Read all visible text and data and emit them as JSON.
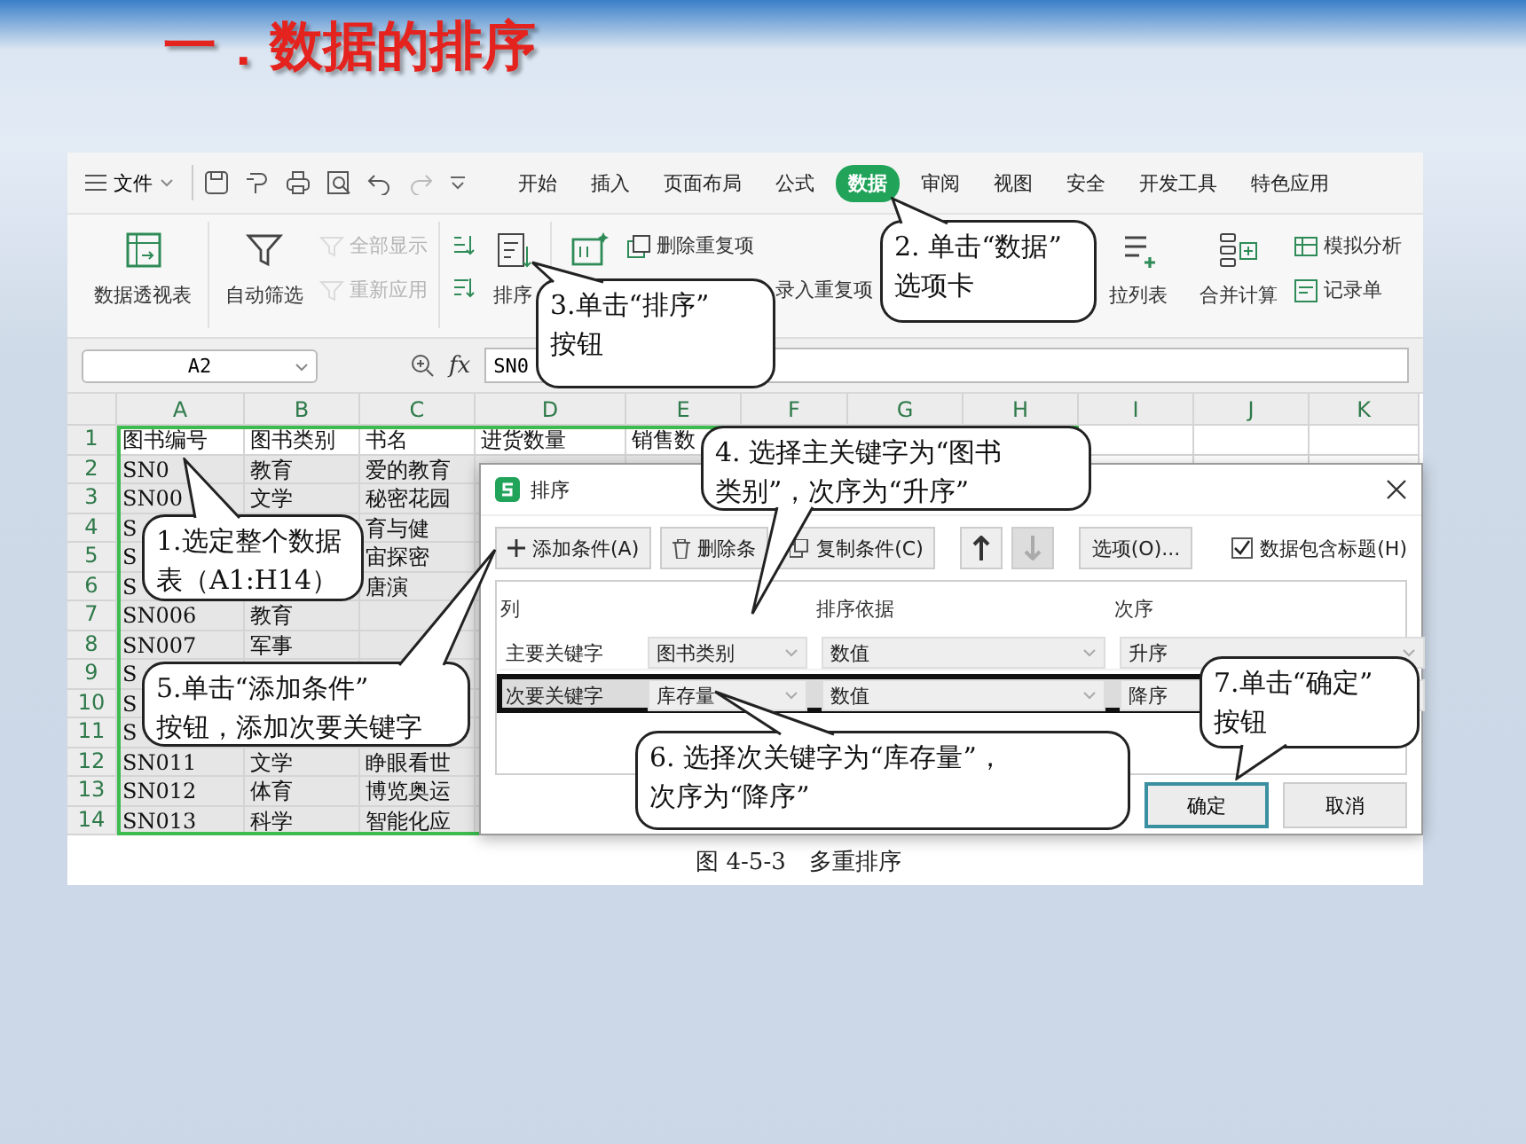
{
  "slide_title": "一．数据的排序",
  "menu": {
    "file": "文件",
    "tabs": [
      {
        "label": "开始",
        "selected": false
      },
      {
        "label": "插入",
        "selected": false
      },
      {
        "label": "页面布局",
        "selected": false
      },
      {
        "label": "公式",
        "selected": false
      },
      {
        "label": "数据",
        "selected": true
      },
      {
        "label": "审阅",
        "selected": false
      },
      {
        "label": "视图",
        "selected": false
      },
      {
        "label": "安全",
        "selected": false
      },
      {
        "label": "开发工具",
        "selected": false
      },
      {
        "label": "特色应用",
        "selected": false
      }
    ]
  },
  "ribbon": {
    "groups": [
      {
        "items": [
          {
            "kind": "large",
            "label": "数据透视表",
            "disabled": false
          }
        ]
      },
      {
        "items": [
          {
            "kind": "large",
            "label": "自动筛选",
            "disabled": false
          },
          {
            "kind": "small",
            "label": "全部显示",
            "disabled": true
          },
          {
            "kind": "small",
            "label": "重新应用",
            "disabled": true
          }
        ]
      },
      {
        "items": [
          {
            "kind": "icon",
            "disabled": false
          },
          {
            "kind": "icon",
            "disabled": false
          },
          {
            "kind": "large",
            "label": "排序",
            "disabled": false
          }
        ]
      },
      {
        "items": [
          {
            "kind": "large",
            "disabled": false
          },
          {
            "kind": "small",
            "label": "删除重复项",
            "disabled": false
          },
          {
            "kind": "small",
            "label": "录入重复项",
            "disabled": false
          }
        ]
      },
      {
        "items": [
          {
            "kind": "large",
            "label": "拉列表",
            "disabled": false
          }
        ]
      },
      {
        "items": [
          {
            "kind": "large",
            "label": "合并计算",
            "disabled": false
          },
          {
            "kind": "small",
            "label": "模拟分析",
            "disabled": false
          },
          {
            "kind": "small",
            "label": "记录单",
            "disabled": false
          }
        ]
      }
    ]
  },
  "formula_bar": {
    "name_box": "A2",
    "fx": "fx",
    "value": "SN0"
  },
  "sheet": {
    "columns": [
      "A",
      "B",
      "C",
      "D",
      "E",
      "F",
      "G",
      "H",
      "I",
      "J",
      "K"
    ],
    "rows": [
      {
        "number": "1",
        "cells": [
          "图书编号",
          "图书类别",
          "书名",
          "进货数量",
          "销售数"
        ]
      },
      {
        "number": "2",
        "cells": [
          "SN0",
          "教育",
          "爱的教育"
        ]
      },
      {
        "number": "3",
        "cells": [
          "SN00",
          "文学",
          "秘密花园"
        ]
      },
      {
        "number": "4",
        "cells": [
          "S",
          "",
          "育与健"
        ]
      },
      {
        "number": "5",
        "cells": [
          "S",
          "",
          "宙探密"
        ]
      },
      {
        "number": "6",
        "cells": [
          "S",
          "",
          "唐演"
        ]
      },
      {
        "number": "7",
        "cells": [
          "SN006",
          "教育",
          ""
        ]
      },
      {
        "number": "8",
        "cells": [
          "SN007",
          "军事",
          ""
        ]
      },
      {
        "number": "9",
        "cells": [
          "S"
        ]
      },
      {
        "number": "10",
        "cells": [
          "S"
        ]
      },
      {
        "number": "11",
        "cells": [
          "S"
        ]
      },
      {
        "number": "12",
        "cells": [
          "SN011",
          "文学",
          "睁眼看世"
        ]
      },
      {
        "number": "13",
        "cells": [
          "SN012",
          "体育",
          "博览奥运"
        ]
      },
      {
        "number": "14",
        "cells": [
          "SN013",
          "科学",
          "智能化应"
        ]
      }
    ]
  },
  "dialog": {
    "title": "排序",
    "toolbar": [
      {
        "kind": "add",
        "label": "添加条件(A)",
        "disabled": false
      },
      {
        "kind": "delete",
        "label": "删除条",
        "disabled": false
      },
      {
        "kind": "copy",
        "label": "复制条件(C)",
        "disabled": false
      },
      {
        "kind": "up",
        "disabled": false
      },
      {
        "kind": "down",
        "disabled": true
      },
      {
        "kind": "plain",
        "label": "选项(O)...",
        "disabled": false
      }
    ],
    "header_checkbox": {
      "label": "数据包含标题(H)",
      "checked": true
    },
    "columns": [
      "列",
      "排序依据",
      "次序"
    ],
    "rows": [
      {
        "label": "主要关键字",
        "column": "图书类别",
        "basis": "数值",
        "order": "升序",
        "selected": false
      },
      {
        "label": "次要关键字",
        "column": "库存量",
        "basis": "数值",
        "order": "降序",
        "selected": true
      }
    ],
    "buttons": [
      {
        "label": "确定",
        "focused": true
      },
      {
        "label": "取消",
        "focused": false
      }
    ]
  },
  "callouts": [
    {
      "lines": [
        "1.选定整个数据",
        "表（A1:H14）"
      ]
    },
    {
      "lines": [
        "2. 单击“数据”",
        "选项卡"
      ]
    },
    {
      "lines": [
        "3.单击“排序”",
        "按钮"
      ]
    },
    {
      "lines": [
        "4.  选择主关键字为“图书",
        "类别”，次序为“升序”"
      ]
    },
    {
      "lines": [
        "5.单击“添加条件”",
        "按钮，添加次要关键字"
      ]
    },
    {
      "lines": [
        "6.  选择次关键字为“库存量”，",
        "次序为“降序”"
      ]
    },
    {
      "lines": [
        "7.单击“确定”",
        "按钮"
      ]
    }
  ],
  "caption": "图 4-5-3　多重排序"
}
